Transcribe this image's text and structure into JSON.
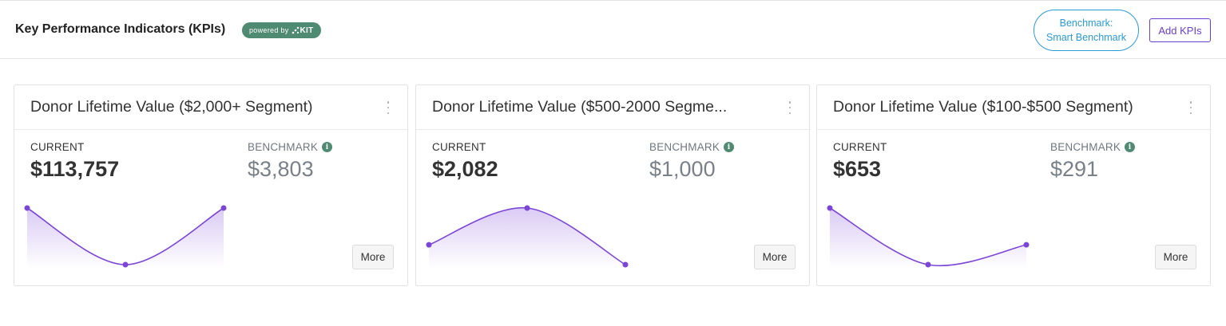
{
  "header": {
    "title": "Key Performance Indicators (KPIs)",
    "powered_by": "powered by",
    "powered_brand": "KIT",
    "benchmark_line1": "Benchmark:",
    "benchmark_line2": "Smart Benchmark",
    "add_kpis": "Add KPIs"
  },
  "colors": {
    "accent_purple": "#6a3fcf",
    "line_purple": "#7b45d8",
    "brand_green": "#4f8a73",
    "benchmark_blue": "#2a9ad6"
  },
  "cards": [
    {
      "title": "Donor Lifetime Value ($2,000+ Segment)",
      "current_label": "CURRENT",
      "current_value": "$113,757",
      "benchmark_label": "BENCHMARK",
      "benchmark_value": "$3,803",
      "more_label": "More",
      "trend": [
        1.0,
        0.0,
        1.0
      ]
    },
    {
      "title": "Donor Lifetime Value ($500-2000 Segme...",
      "current_label": "CURRENT",
      "current_value": "$2,082",
      "benchmark_label": "BENCHMARK",
      "benchmark_value": "$1,000",
      "more_label": "More",
      "trend": [
        0.35,
        1.0,
        0.0
      ]
    },
    {
      "title": "Donor Lifetime Value ($100-$500 Segment)",
      "current_label": "CURRENT",
      "current_value": "$653",
      "benchmark_label": "BENCHMARK",
      "benchmark_value": "$291",
      "more_label": "More",
      "trend": [
        1.0,
        0.0,
        0.35
      ]
    }
  ]
}
